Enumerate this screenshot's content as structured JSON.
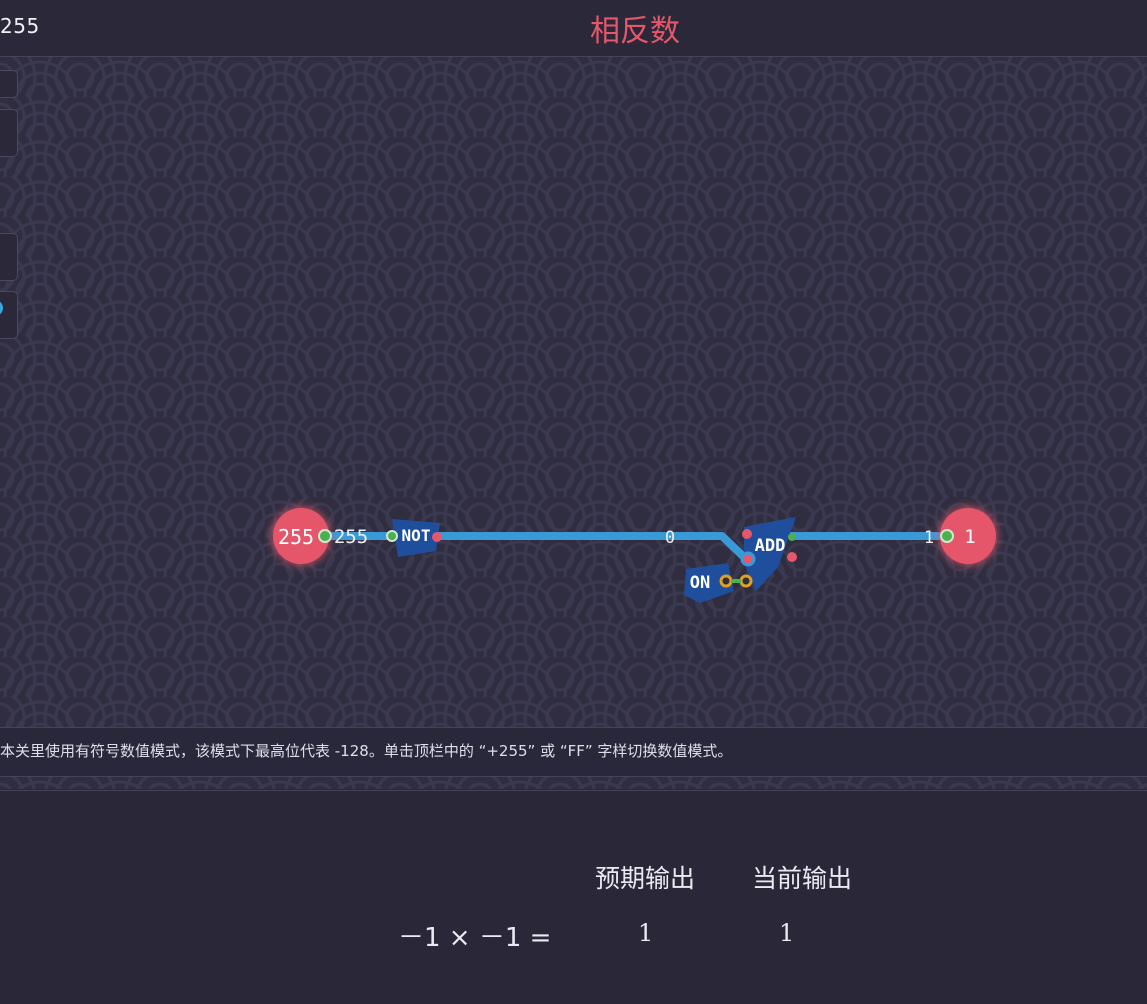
{
  "topbar": {
    "value_mode": "255",
    "level_title": "相反数"
  },
  "circuit": {
    "input_value": "255",
    "not_input_label": "255",
    "not_label": "NOT",
    "wire_value": "0",
    "add_label": "ADD",
    "on_label": "ON",
    "output_wire_value": "1",
    "output_value": "1"
  },
  "hint": {
    "text": "本关里使用有符号数值模式，该模式下最高位代表 -128。单击顶栏中的 “+255” 或 “FF” 字样切换数值模式。"
  },
  "results": {
    "expected_header": "预期输出",
    "current_header": "当前输出",
    "equation": "－1 × －1 =",
    "expected_value": "1",
    "current_value": "1"
  },
  "colors": {
    "accent_red": "#e5576a",
    "wire_blue": "#3a9ad8",
    "node_green": "#4caf50",
    "gate_blue": "#1f4f9c"
  }
}
